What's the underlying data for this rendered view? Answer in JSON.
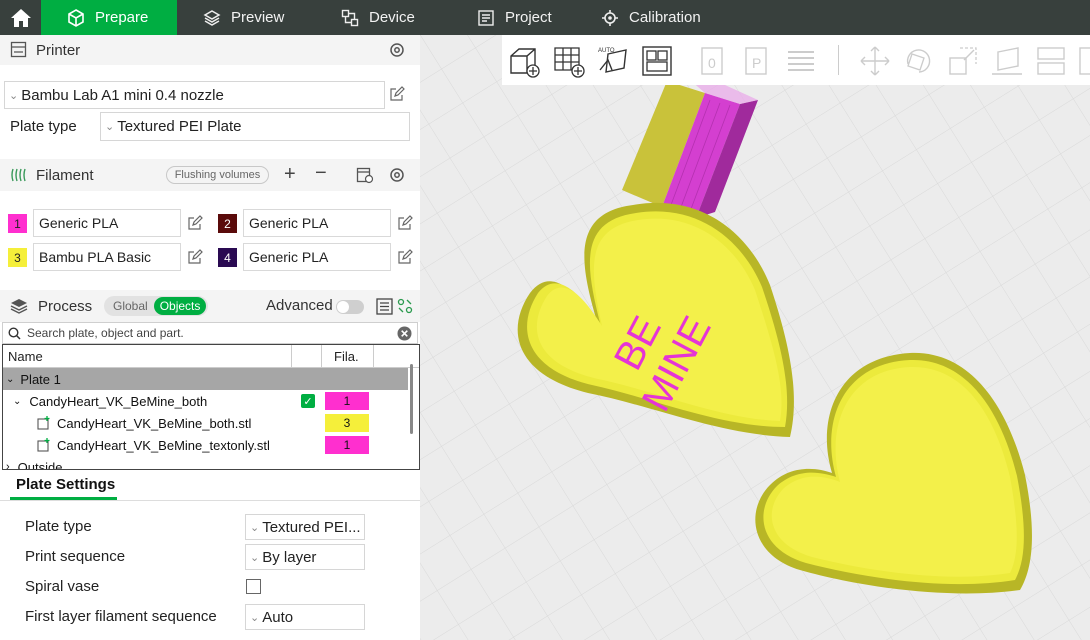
{
  "tabs": [
    {
      "label": "Prepare"
    },
    {
      "label": "Preview"
    },
    {
      "label": "Device"
    },
    {
      "label": "Project"
    },
    {
      "label": "Calibration"
    }
  ],
  "printer": {
    "section_title": "Printer",
    "selected": "Bambu Lab A1 mini 0.4 nozzle",
    "plate_type_label": "Plate type",
    "plate_type_value": "Textured PEI Plate"
  },
  "filament": {
    "section_title": "Filament",
    "flushing_label": "Flushing volumes",
    "slots": [
      {
        "num": "1",
        "name": "Generic PLA",
        "color": "#ff2fcf",
        "text_color": "#222"
      },
      {
        "num": "2",
        "name": "Generic PLA",
        "color": "#5a0a0a",
        "text_color": "#fff"
      },
      {
        "num": "3",
        "name": "Bambu PLA Basic",
        "color": "#f5ef3a",
        "text_color": "#222"
      },
      {
        "num": "4",
        "name": "Generic PLA",
        "color": "#2a0a52",
        "text_color": "#fff"
      }
    ]
  },
  "process": {
    "section_title": "Process",
    "toggle_global": "Global",
    "toggle_objects": "Objects",
    "advanced_label": "Advanced",
    "search_placeholder": "Search plate, object and part."
  },
  "object_list": {
    "col_name": "Name",
    "col_fila": "Fila.",
    "rows": [
      {
        "name": "Plate 1",
        "fila": ""
      },
      {
        "name": "CandyHeart_VK_BeMine_both",
        "fila": "1",
        "fila_color": "#ff2fcf"
      },
      {
        "name": "CandyHeart_VK_BeMine_both.stl",
        "fila": "3",
        "fila_color": "#f5ef3a"
      },
      {
        "name": "CandyHeart_VK_BeMine_textonly.stl",
        "fila": "1",
        "fila_color": "#ff2fcf"
      },
      {
        "name": "Outside",
        "fila": ""
      }
    ]
  },
  "plate_settings": {
    "tab_label": "Plate Settings",
    "plate_type_label": "Plate type",
    "plate_type_value": "Textured PEI...",
    "print_sequence_label": "Print sequence",
    "print_sequence_value": "By layer",
    "spiral_vase_label": "Spiral vase",
    "first_layer_label": "First layer filament sequence",
    "first_layer_value": "Auto"
  },
  "model_text": {
    "line1": "BE",
    "line2": "MINE"
  },
  "colors": {
    "accent": "#00ae42",
    "topbar": "#38403d",
    "heart_yellow": "#ecea3c",
    "text_magenta": "#e534d6"
  }
}
